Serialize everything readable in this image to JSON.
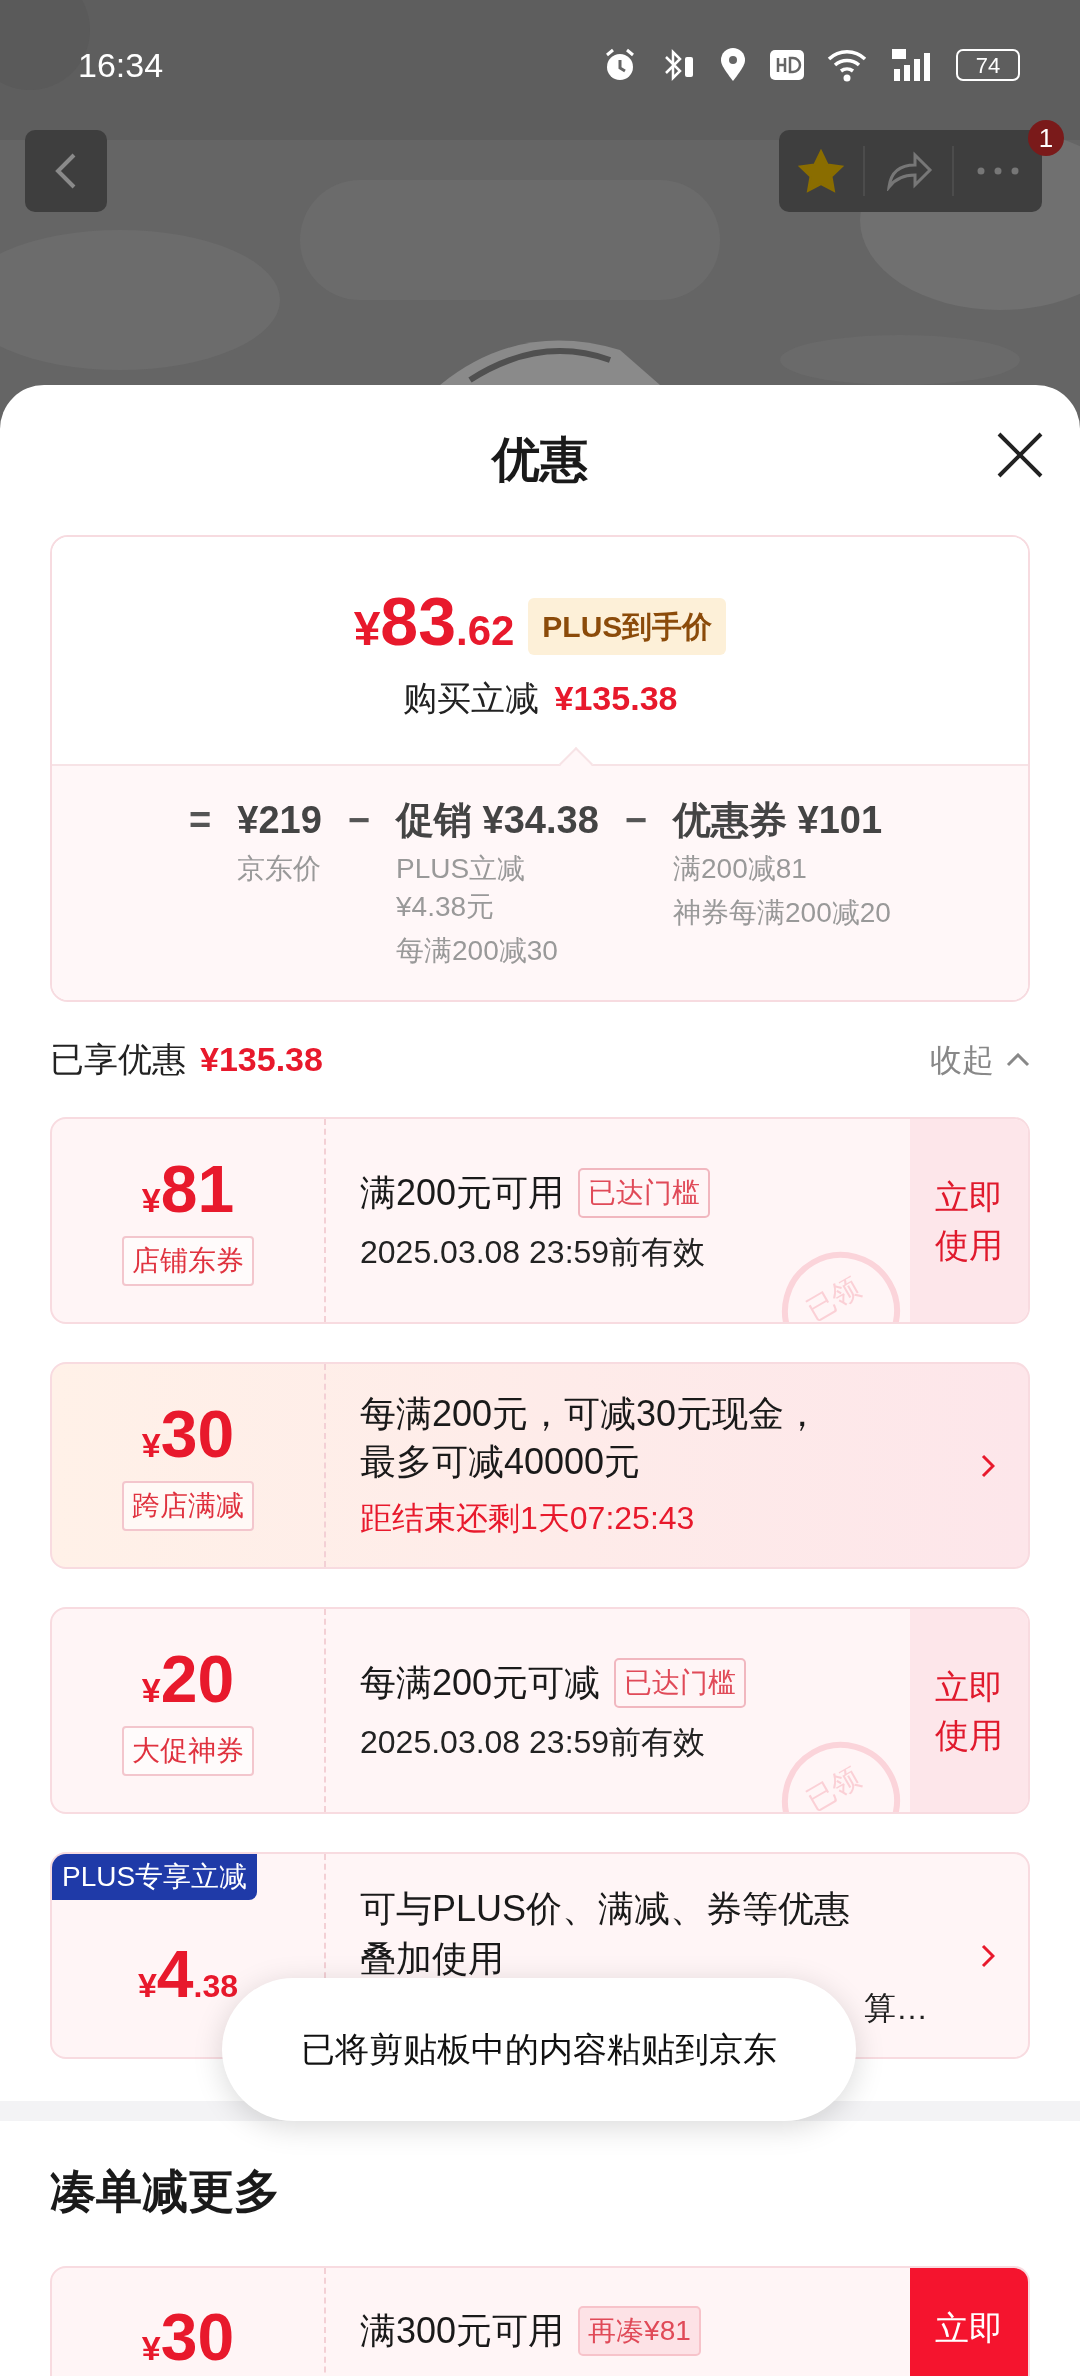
{
  "status_bar": {
    "time": "16:34",
    "battery": "74"
  },
  "nav": {
    "badge": "1",
    "favorited": true
  },
  "sheet": {
    "title": "优惠"
  },
  "summary": {
    "currency": "¥",
    "price_int": "83",
    "price_dec": ".62",
    "price_tag": "PLUS到手价",
    "saving_label": "购买立减",
    "saving_value": "¥135.38",
    "breakdown": [
      {
        "operator": "=",
        "value": "¥219",
        "notes": [
          "京东价"
        ]
      },
      {
        "operator": "−",
        "value": "促销 ¥34.38",
        "notes": [
          "PLUS立减\n¥4.38元",
          "每满200减30"
        ]
      },
      {
        "operator": "−",
        "value": "优惠券 ¥101",
        "notes": [
          "满200减81",
          "神券每满200减20"
        ]
      }
    ]
  },
  "enjoyed": {
    "label": "已享优惠",
    "value": "¥135.38",
    "toggle": "收起",
    "expanded": true
  },
  "coupons": [
    {
      "kind": "store",
      "currency": "¥",
      "amount": "81",
      "tag": "店铺东券",
      "title": "满200元可用",
      "badge": "已达门槛",
      "subtitle": "2025.03.08 23:59前有效",
      "stamp": "已领",
      "action": "立即使用"
    },
    {
      "kind": "event",
      "currency": "¥",
      "amount": "30",
      "tag": "跨店满减",
      "title": "每满200元，可减30元现金，最多可减40000元",
      "countdown": "距结束还剩1天07:25:43"
    },
    {
      "kind": "store",
      "currency": "¥",
      "amount": "20",
      "tag": "大促神券",
      "title": "每满200元可减",
      "badge": "已达门槛",
      "subtitle": "2025.03.08 23:59前有效",
      "stamp": "已领",
      "action": "立即使用"
    },
    {
      "kind": "plus",
      "currency": "¥",
      "amount": "4",
      "amount_dec": ".38",
      "label": "PLUS专享立减",
      "title": "可与PLUS价、满减、券等优惠叠加使用",
      "tail": "算…"
    }
  ],
  "toast": "已将剪贴板中的内容粘贴到京东",
  "more": {
    "title": "凑单减更多",
    "coupons": [
      {
        "kind": "target",
        "currency": "¥",
        "amount": "30",
        "title": "满300元可用",
        "badge": "再凑¥81",
        "action": "立即"
      }
    ]
  }
}
